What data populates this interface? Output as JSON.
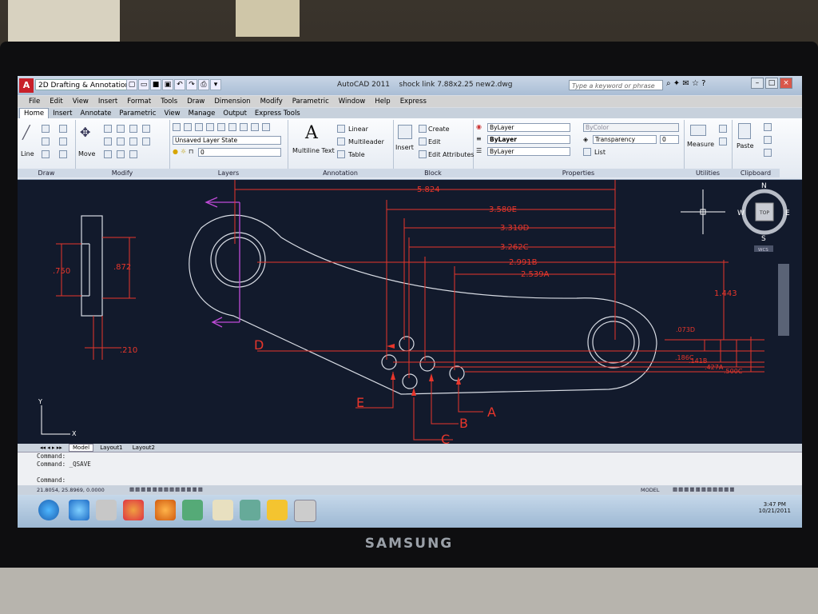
{
  "window": {
    "app_title": "AutoCAD 2011",
    "file_name": "shock link 7.88x2.25 new2.dwg",
    "workspace": "2D Drafting & Annotation",
    "search_placeholder": "Type a keyword or phrase"
  },
  "menubar": [
    "File",
    "Edit",
    "View",
    "Insert",
    "Format",
    "Tools",
    "Draw",
    "Dimension",
    "Modify",
    "Parametric",
    "Window",
    "Help",
    "Express"
  ],
  "ribbon_tabs": [
    "Home",
    "Insert",
    "Annotate",
    "Parametric",
    "View",
    "Manage",
    "Output",
    "Express Tools"
  ],
  "ribbon": {
    "draw": {
      "label": "Draw",
      "line": "Line"
    },
    "modify": {
      "label": "Modify",
      "move": "Move"
    },
    "layers": {
      "label": "Layers",
      "state": "Unsaved Layer State",
      "current": "0"
    },
    "annotation": {
      "label": "Annotation",
      "text": "Multiline Text",
      "linear": "Linear",
      "multileader": "Multileader",
      "table": "Table"
    },
    "block": {
      "label": "Block",
      "insert": "Insert",
      "create": "Create",
      "edit": "Edit",
      "edit_attributes": "Edit Attributes"
    },
    "properties": {
      "label": "Properties",
      "color": "ByLayer",
      "linetype": "ByLayer",
      "lineweight": "ByLayer",
      "plot": "ByColor",
      "transparency": "Transparency",
      "transparency_value": "0",
      "list": "List"
    },
    "utilities": {
      "label": "Utilities",
      "measure": "Measure"
    },
    "clipboard": {
      "label": "Clipboard",
      "paste": "Paste"
    }
  },
  "dimensions": {
    "d5824": "5.824",
    "d3580": "3.580E",
    "d3310": "3.310D",
    "d3262": "3.262C",
    "d2991": "2.991B",
    "d2539": "2.539A",
    "d750": ".750",
    "d872": ".872",
    "d210": ".210",
    "d1443": "1.443",
    "d073": ".073D",
    "d186": ".186C",
    "d141": ".141B",
    "d427": ".427A",
    "d500": ".500C"
  },
  "labels": {
    "A": "A",
    "B": "B",
    "C": "C",
    "D": "D",
    "E": "E"
  },
  "viewcube": {
    "n": "N",
    "s": "S",
    "e": "E",
    "w": "W",
    "top": "TOP",
    "wcs": "WCS"
  },
  "ucs": {
    "y": "Y",
    "x": "X"
  },
  "layout_tabs": [
    "Model",
    "Layout1",
    "Layout2"
  ],
  "command_lines": [
    "Command:",
    "Command:  _QSAVE",
    "Command:"
  ],
  "status": {
    "coords": "21.8054, 25.8969, 0.0000",
    "model": "MODEL"
  },
  "clock": {
    "time": "3:47 PM",
    "date": "10/21/2011"
  },
  "monitor_brand": "SAMSUNG",
  "colors": {
    "accent": "#c8202a",
    "dim_red": "#e8362b",
    "magenta": "#c04bd8",
    "line_white": "#d8dce4",
    "background": "#121a2c"
  }
}
